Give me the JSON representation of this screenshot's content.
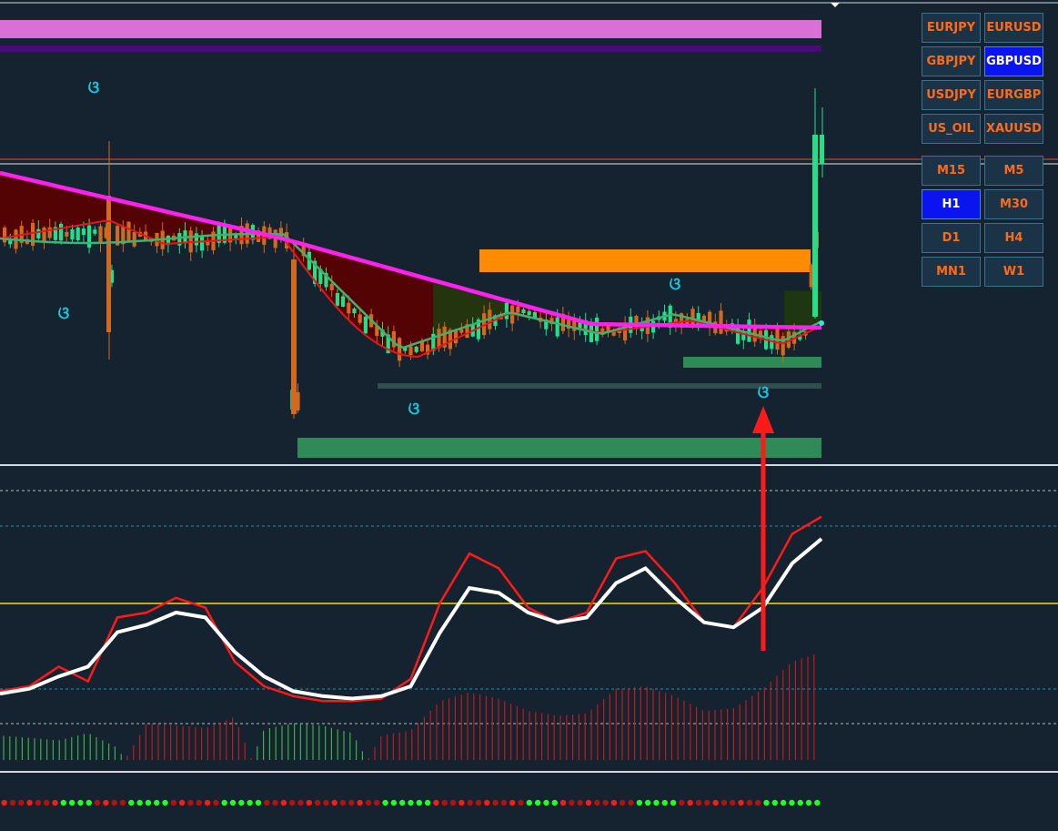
{
  "symbols_panel": {
    "symbols": [
      {
        "label": "EURJPY",
        "active": false
      },
      {
        "label": "EURUSD",
        "active": false
      },
      {
        "label": "GBPJPY",
        "active": false
      },
      {
        "label": "GBPUSD",
        "active": true
      },
      {
        "label": "USDJPY",
        "active": false
      },
      {
        "label": "EURGBP",
        "active": false
      },
      {
        "label": "US_OIL",
        "active": false
      },
      {
        "label": "XAUUSD",
        "active": false
      }
    ],
    "timeframes": [
      {
        "label": "M15",
        "active": false
      },
      {
        "label": "M5",
        "active": false
      },
      {
        "label": "H1",
        "active": true
      },
      {
        "label": "M30",
        "active": false
      },
      {
        "label": "D1",
        "active": false
      },
      {
        "label": "H4",
        "active": false
      },
      {
        "label": "MN1",
        "active": false
      },
      {
        "label": "W1",
        "active": false
      }
    ]
  },
  "colors": {
    "background": "#14232f",
    "bull_candle": "#21e08a",
    "bear_candle": "#d2691e",
    "magenta_ma": "#ff22ee",
    "red_ma": "#e01a1a",
    "green_ma": "#3cb371",
    "cloud_bear": "#5a0000",
    "cloud_bull": "#1f3a10",
    "resistance_zone": "#ff8c00",
    "support_zone": "#2e8b57",
    "osc_fast": "#ff1a1a",
    "osc_slow": "#ffffff",
    "level_line": "#ffd700",
    "arrow": "#ff1a1a",
    "signal_label": "#19c8e0"
  },
  "chart_data": {
    "type": "candlestick",
    "price_panel": {
      "signal_symbol": "ଓ",
      "signals": [
        {
          "index": 3
        },
        {
          "index": 2
        },
        {
          "index": 14
        },
        {
          "index": 24
        },
        {
          "index": 27
        }
      ]
    },
    "oscillator_panel": {
      "fast_line": [
        28,
        30,
        38,
        32,
        58,
        60,
        66,
        62,
        40,
        30,
        26,
        24,
        24,
        25,
        33,
        64,
        84,
        78,
        62,
        56,
        60,
        82,
        85,
        72,
        56,
        54,
        70,
        92,
        99
      ],
      "slow_line": [
        27,
        29,
        34,
        38,
        52,
        55,
        60,
        58,
        44,
        34,
        28,
        26,
        25,
        26,
        30,
        52,
        70,
        68,
        60,
        56,
        58,
        72,
        78,
        66,
        56,
        54,
        62,
        80,
        90
      ],
      "histogram": [
        -20,
        -18,
        -16,
        -22,
        -10,
        30,
        28,
        26,
        35,
        -25,
        -30,
        -28,
        -22,
        20,
        24,
        48,
        55,
        50,
        40,
        36,
        38,
        58,
        60,
        52,
        40,
        42,
        58,
        80,
        88
      ],
      "level": 66
    },
    "signal_dots": [
      "r",
      "r",
      "r",
      "r",
      "r",
      "r",
      "r",
      "g",
      "g",
      "g",
      "g",
      "r",
      "r",
      "r",
      "r",
      "g",
      "g",
      "g",
      "g",
      "g",
      "r",
      "r",
      "r",
      "r",
      "r",
      "r",
      "g",
      "g",
      "g",
      "g",
      "g",
      "r",
      "r",
      "r",
      "r",
      "r",
      "r",
      "r",
      "r",
      "r",
      "r",
      "r",
      "r",
      "r",
      "r",
      "g",
      "g",
      "g",
      "g",
      "g",
      "g",
      "r",
      "r",
      "r",
      "r",
      "r",
      "r",
      "r",
      "r",
      "r",
      "r",
      "r",
      "g",
      "g",
      "g",
      "g",
      "r",
      "r",
      "r",
      "r",
      "r",
      "r",
      "r",
      "r",
      "r",
      "g",
      "g",
      "g",
      "g",
      "g",
      "r",
      "r",
      "r",
      "r",
      "r",
      "r",
      "r",
      "r",
      "r",
      "r",
      "g",
      "g",
      "g",
      "g",
      "g",
      "g",
      "g"
    ]
  }
}
